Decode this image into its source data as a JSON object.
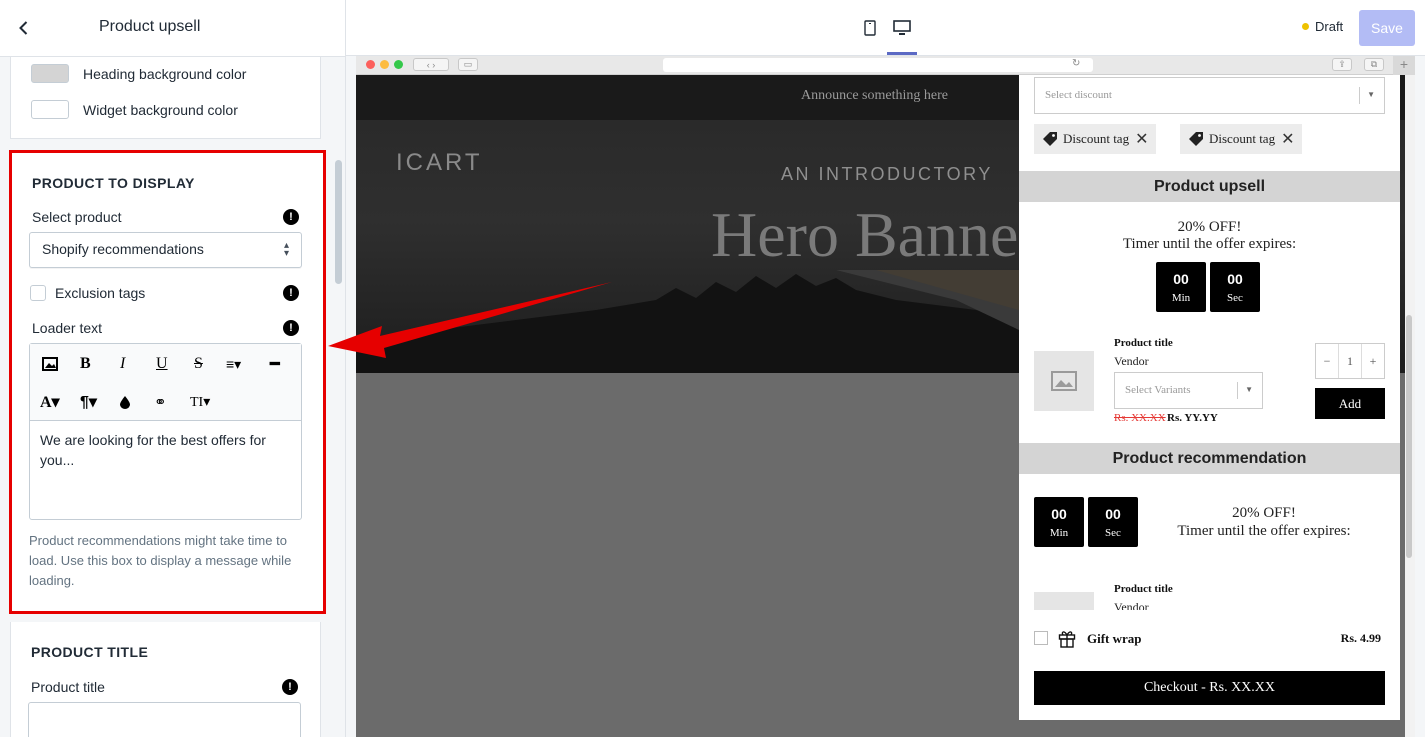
{
  "sidebar": {
    "title": "Product upsell",
    "colors": [
      {
        "label": "Heading background color",
        "swatch": "#d4d4d4"
      },
      {
        "label": "Widget background color",
        "swatch": "#ffffff"
      }
    ],
    "product_section": {
      "heading": "PRODUCT TO DISPLAY",
      "select_label": "Select product",
      "select_value": "Shopify recommendations",
      "exclusion_label": "Exclusion tags",
      "loader_label": "Loader text",
      "loader_value": "We are looking for the best offers for you...",
      "help": "Product recommendations might take time to load. Use this box to display a message while loading."
    },
    "title_section": {
      "heading": "PRODUCT TITLE",
      "field_label": "Product title"
    }
  },
  "topbar": {
    "status": "Draft",
    "save_label": "Save"
  },
  "preview": {
    "announcement": "Announce something here",
    "logo": "ICART",
    "hero_subtitle": "AN INTRODUCTORY",
    "hero_title": "Hero Banner"
  },
  "widget": {
    "discount_placeholder": "Select discount",
    "tags": [
      "Discount tag",
      "Discount tag"
    ],
    "upsell": {
      "heading": "Product upsell",
      "offer": "20% OFF!",
      "timer_text": "Timer until the offer expires:",
      "minutes": "00",
      "min_label": "Min",
      "seconds": "00",
      "sec_label": "Sec",
      "product_title": "Product title",
      "vendor": "Vendor",
      "variant_placeholder": "Select Variants",
      "price_old": "Rs. XX.XX",
      "price_new": "Rs. YY.YY",
      "qty_minus": "−",
      "qty": "1",
      "qty_plus": "+",
      "add_label": "Add"
    },
    "recommendation": {
      "heading": "Product recommendation",
      "offer": "20% OFF!",
      "timer_text": "Timer until the offer expires:",
      "minutes": "00",
      "min_label": "Min",
      "seconds": "00",
      "sec_label": "Sec",
      "product_title": "Product title",
      "vendor": "Vendor"
    },
    "gift_label": "Gift wrap",
    "gift_price": "Rs. 4.99",
    "checkout_label": "Checkout - Rs. XX.XX"
  },
  "icons": {
    "back": "chevron-left-icon",
    "info": "!",
    "mobile": "mobile-icon",
    "desktop": "desktop-icon"
  },
  "colors": {
    "accent": "#5c6ac4",
    "save_disabled": "#b3bcf5",
    "draft_dot": "#eec200",
    "highlight_border": "#e60000"
  }
}
